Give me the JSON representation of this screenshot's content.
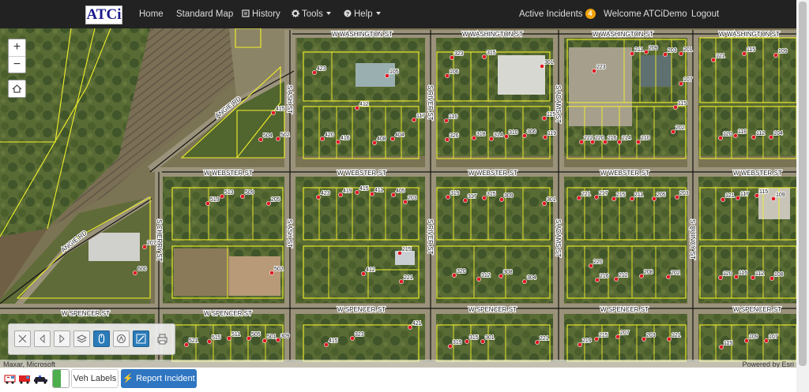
{
  "nav": {
    "logo": "ATCi",
    "home": "Home",
    "standard_map": "Standard Map",
    "history": "History",
    "tools": "Tools",
    "help": "Help",
    "active_incidents": "Active Incidents",
    "active_incidents_count": "4",
    "welcome": "Welcome ATCiDemo",
    "logout": "Logout"
  },
  "map": {
    "streets": {
      "w_washington_st": "W WASHINGTON ST",
      "w_webster_st": "W WEBSTER ST",
      "w_spencer_st": "W SPENCER ST",
      "s_cherry_st": "S CHERRY ST",
      "s_ash_st": "S ASH ST",
      "s_river_st": "S RIVER ST",
      "s_adams_st": "S ADAMS ST",
      "s_quincy_st": "S QUINCY ST",
      "angie_rd": "ANGIE RD"
    },
    "addresses": [
      "423",
      "105",
      "412",
      "415",
      "420",
      "416",
      "408",
      "404",
      "117",
      "504",
      "502",
      "323",
      "315",
      "106",
      "301",
      "116",
      "326",
      "318",
      "314",
      "310",
      "306",
      "115",
      "119",
      "223",
      "211",
      "209",
      "203",
      "201",
      "107",
      "115",
      "202",
      "222",
      "220",
      "216",
      "214",
      "210",
      "121",
      "115",
      "109",
      "120",
      "118",
      "112",
      "104",
      "519",
      "513",
      "509",
      "205",
      "423",
      "419",
      "415",
      "411",
      "405",
      "203",
      "319",
      "317",
      "315",
      "309",
      "301",
      "221",
      "217",
      "215",
      "211",
      "205",
      "203",
      "121",
      "117",
      "115",
      "109",
      "207",
      "502",
      "600",
      "215",
      "412",
      "221",
      "320",
      "312",
      "308",
      "304",
      "220",
      "216",
      "212",
      "208",
      "202",
      "120",
      "116",
      "112",
      "108",
      "521",
      "515",
      "511",
      "505",
      "501",
      "309",
      "421",
      "415",
      "323",
      "319",
      "315",
      "301",
      "221",
      "219",
      "215",
      "207",
      "203",
      "121",
      "115",
      "109",
      "107"
    ],
    "attribution": "Maxar, Microsoft",
    "powered_by": "Powered by Esri"
  },
  "controls": {
    "zoom_in": "+",
    "zoom_out": "−"
  },
  "toolbar": {
    "tools": [
      "close-tool",
      "prev-extent-tool",
      "next-extent-tool",
      "layers-tool",
      "identify-tool",
      "measure-tool",
      "draw-tool",
      "print-tool"
    ]
  },
  "bottom": {
    "veh_labels": "Veh Labels",
    "report_incident": "Report Incident"
  },
  "colors": {
    "parcel_outline": "#f2f02a",
    "marker": "#e0141e",
    "accent": "#2e76c1",
    "badge": "#f0a30a"
  }
}
